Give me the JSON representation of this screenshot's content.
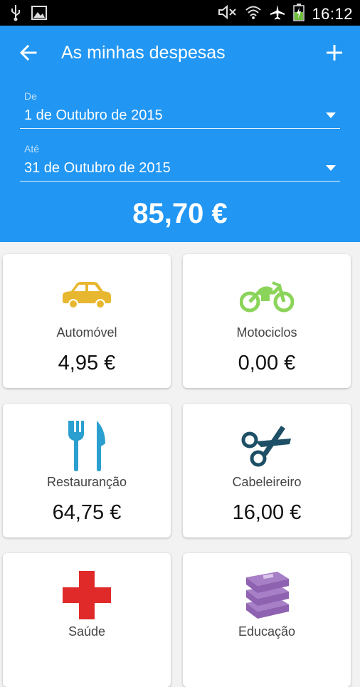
{
  "status_bar": {
    "time": "16:12",
    "icons": [
      "usb-icon",
      "image-icon",
      "mute-icon",
      "wifi-icon",
      "airplane-icon",
      "battery-charging-icon"
    ]
  },
  "header": {
    "title": "As minhas despesas",
    "back_icon": "arrow-left-icon",
    "add_icon": "plus-icon",
    "from_label": "De",
    "from_value": "1 de Outubro de 2015",
    "to_label": "Até",
    "to_value": "31 de Outubro de 2015",
    "total": "85,70 €",
    "color": "#2196f3"
  },
  "categories": [
    {
      "label": "Automóvel",
      "amount": "4,95 €",
      "icon": "car-icon",
      "color": "#e8b730"
    },
    {
      "label": "Motociclos",
      "amount": "0,00 €",
      "icon": "motorcycle-icon",
      "color": "#8bd45a"
    },
    {
      "label": "Restauranção",
      "amount": "64,75 €",
      "icon": "fork-knife-icon",
      "color": "#2a9fd0"
    },
    {
      "label": "Cabeleireiro",
      "amount": "16,00 €",
      "icon": "scissors-icon",
      "color": "#1d4f66"
    },
    {
      "label": "Saúde",
      "amount": "",
      "icon": "red-cross-icon",
      "color": "#e02a2a"
    },
    {
      "label": "Educação",
      "amount": "",
      "icon": "books-icon",
      "color": "#8e62b0"
    }
  ]
}
